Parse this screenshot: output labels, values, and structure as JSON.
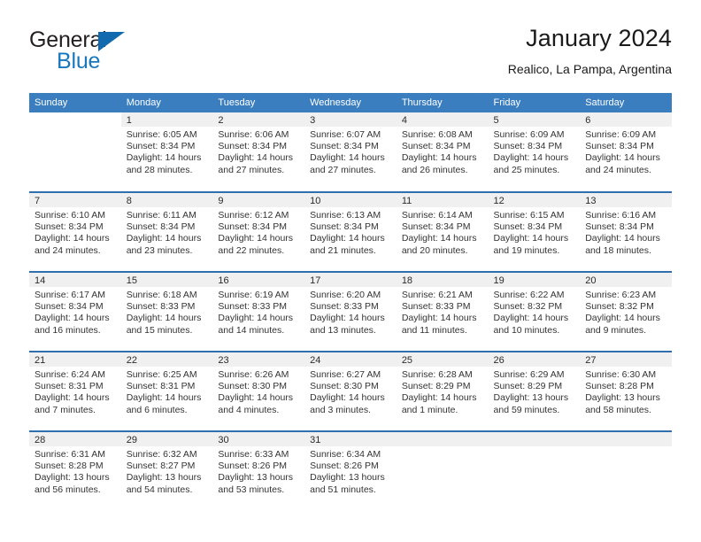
{
  "brand": {
    "name_top": "General",
    "name_bottom": "Blue",
    "triangle_icon": "triangle-icon"
  },
  "header": {
    "title": "January 2024",
    "subtitle": "Realico, La Pampa, Argentina"
  },
  "colors": {
    "header_blue": "#3a7ebf",
    "row_divider_blue": "#2f6fb0",
    "daynum_band": "#f0f0f0",
    "brand_blue": "#1878be",
    "brand_triangle": "#1169ae",
    "text": "#333333"
  },
  "weekday_headers": [
    "Sunday",
    "Monday",
    "Tuesday",
    "Wednesday",
    "Thursday",
    "Friday",
    "Saturday"
  ],
  "labels": {
    "sunrise_prefix": "Sunrise:",
    "sunset_prefix": "Sunset:",
    "daylight_prefix": "Daylight:"
  },
  "weeks": [
    {
      "days": [
        {
          "num": "",
          "empty": true,
          "band": false,
          "sunrise": "",
          "sunset": "",
          "daylight_a": "",
          "daylight_b": ""
        },
        {
          "num": "1",
          "sunrise": "Sunrise: 6:05 AM",
          "sunset": "Sunset: 8:34 PM",
          "daylight_a": "Daylight: 14 hours",
          "daylight_b": "and 28 minutes."
        },
        {
          "num": "2",
          "sunrise": "Sunrise: 6:06 AM",
          "sunset": "Sunset: 8:34 PM",
          "daylight_a": "Daylight: 14 hours",
          "daylight_b": "and 27 minutes."
        },
        {
          "num": "3",
          "sunrise": "Sunrise: 6:07 AM",
          "sunset": "Sunset: 8:34 PM",
          "daylight_a": "Daylight: 14 hours",
          "daylight_b": "and 27 minutes."
        },
        {
          "num": "4",
          "sunrise": "Sunrise: 6:08 AM",
          "sunset": "Sunset: 8:34 PM",
          "daylight_a": "Daylight: 14 hours",
          "daylight_b": "and 26 minutes."
        },
        {
          "num": "5",
          "sunrise": "Sunrise: 6:09 AM",
          "sunset": "Sunset: 8:34 PM",
          "daylight_a": "Daylight: 14 hours",
          "daylight_b": "and 25 minutes."
        },
        {
          "num": "6",
          "sunrise": "Sunrise: 6:09 AM",
          "sunset": "Sunset: 8:34 PM",
          "daylight_a": "Daylight: 14 hours",
          "daylight_b": "and 24 minutes."
        }
      ]
    },
    {
      "days": [
        {
          "num": "7",
          "sunrise": "Sunrise: 6:10 AM",
          "sunset": "Sunset: 8:34 PM",
          "daylight_a": "Daylight: 14 hours",
          "daylight_b": "and 24 minutes."
        },
        {
          "num": "8",
          "sunrise": "Sunrise: 6:11 AM",
          "sunset": "Sunset: 8:34 PM",
          "daylight_a": "Daylight: 14 hours",
          "daylight_b": "and 23 minutes."
        },
        {
          "num": "9",
          "sunrise": "Sunrise: 6:12 AM",
          "sunset": "Sunset: 8:34 PM",
          "daylight_a": "Daylight: 14 hours",
          "daylight_b": "and 22 minutes."
        },
        {
          "num": "10",
          "sunrise": "Sunrise: 6:13 AM",
          "sunset": "Sunset: 8:34 PM",
          "daylight_a": "Daylight: 14 hours",
          "daylight_b": "and 21 minutes."
        },
        {
          "num": "11",
          "sunrise": "Sunrise: 6:14 AM",
          "sunset": "Sunset: 8:34 PM",
          "daylight_a": "Daylight: 14 hours",
          "daylight_b": "and 20 minutes."
        },
        {
          "num": "12",
          "sunrise": "Sunrise: 6:15 AM",
          "sunset": "Sunset: 8:34 PM",
          "daylight_a": "Daylight: 14 hours",
          "daylight_b": "and 19 minutes."
        },
        {
          "num": "13",
          "sunrise": "Sunrise: 6:16 AM",
          "sunset": "Sunset: 8:34 PM",
          "daylight_a": "Daylight: 14 hours",
          "daylight_b": "and 18 minutes."
        }
      ]
    },
    {
      "days": [
        {
          "num": "14",
          "sunrise": "Sunrise: 6:17 AM",
          "sunset": "Sunset: 8:34 PM",
          "daylight_a": "Daylight: 14 hours",
          "daylight_b": "and 16 minutes."
        },
        {
          "num": "15",
          "sunrise": "Sunrise: 6:18 AM",
          "sunset": "Sunset: 8:33 PM",
          "daylight_a": "Daylight: 14 hours",
          "daylight_b": "and 15 minutes."
        },
        {
          "num": "16",
          "sunrise": "Sunrise: 6:19 AM",
          "sunset": "Sunset: 8:33 PM",
          "daylight_a": "Daylight: 14 hours",
          "daylight_b": "and 14 minutes."
        },
        {
          "num": "17",
          "sunrise": "Sunrise: 6:20 AM",
          "sunset": "Sunset: 8:33 PM",
          "daylight_a": "Daylight: 14 hours",
          "daylight_b": "and 13 minutes."
        },
        {
          "num": "18",
          "sunrise": "Sunrise: 6:21 AM",
          "sunset": "Sunset: 8:33 PM",
          "daylight_a": "Daylight: 14 hours",
          "daylight_b": "and 11 minutes."
        },
        {
          "num": "19",
          "sunrise": "Sunrise: 6:22 AM",
          "sunset": "Sunset: 8:32 PM",
          "daylight_a": "Daylight: 14 hours",
          "daylight_b": "and 10 minutes."
        },
        {
          "num": "20",
          "sunrise": "Sunrise: 6:23 AM",
          "sunset": "Sunset: 8:32 PM",
          "daylight_a": "Daylight: 14 hours",
          "daylight_b": "and 9 minutes."
        }
      ]
    },
    {
      "days": [
        {
          "num": "21",
          "sunrise": "Sunrise: 6:24 AM",
          "sunset": "Sunset: 8:31 PM",
          "daylight_a": "Daylight: 14 hours",
          "daylight_b": "and 7 minutes."
        },
        {
          "num": "22",
          "sunrise": "Sunrise: 6:25 AM",
          "sunset": "Sunset: 8:31 PM",
          "daylight_a": "Daylight: 14 hours",
          "daylight_b": "and 6 minutes."
        },
        {
          "num": "23",
          "sunrise": "Sunrise: 6:26 AM",
          "sunset": "Sunset: 8:30 PM",
          "daylight_a": "Daylight: 14 hours",
          "daylight_b": "and 4 minutes."
        },
        {
          "num": "24",
          "sunrise": "Sunrise: 6:27 AM",
          "sunset": "Sunset: 8:30 PM",
          "daylight_a": "Daylight: 14 hours",
          "daylight_b": "and 3 minutes."
        },
        {
          "num": "25",
          "sunrise": "Sunrise: 6:28 AM",
          "sunset": "Sunset: 8:29 PM",
          "daylight_a": "Daylight: 14 hours",
          "daylight_b": "and 1 minute."
        },
        {
          "num": "26",
          "sunrise": "Sunrise: 6:29 AM",
          "sunset": "Sunset: 8:29 PM",
          "daylight_a": "Daylight: 13 hours",
          "daylight_b": "and 59 minutes."
        },
        {
          "num": "27",
          "sunrise": "Sunrise: 6:30 AM",
          "sunset": "Sunset: 8:28 PM",
          "daylight_a": "Daylight: 13 hours",
          "daylight_b": "and 58 minutes."
        }
      ]
    },
    {
      "days": [
        {
          "num": "28",
          "sunrise": "Sunrise: 6:31 AM",
          "sunset": "Sunset: 8:28 PM",
          "daylight_a": "Daylight: 13 hours",
          "daylight_b": "and 56 minutes."
        },
        {
          "num": "29",
          "sunrise": "Sunrise: 6:32 AM",
          "sunset": "Sunset: 8:27 PM",
          "daylight_a": "Daylight: 13 hours",
          "daylight_b": "and 54 minutes."
        },
        {
          "num": "30",
          "sunrise": "Sunrise: 6:33 AM",
          "sunset": "Sunset: 8:26 PM",
          "daylight_a": "Daylight: 13 hours",
          "daylight_b": "and 53 minutes."
        },
        {
          "num": "31",
          "sunrise": "Sunrise: 6:34 AM",
          "sunset": "Sunset: 8:26 PM",
          "daylight_a": "Daylight: 13 hours",
          "daylight_b": "and 51 minutes."
        },
        {
          "num": "",
          "empty": true,
          "band": true,
          "sunrise": "",
          "sunset": "",
          "daylight_a": "",
          "daylight_b": ""
        },
        {
          "num": "",
          "empty": true,
          "band": true,
          "sunrise": "",
          "sunset": "",
          "daylight_a": "",
          "daylight_b": ""
        },
        {
          "num": "",
          "empty": true,
          "band": true,
          "sunrise": "",
          "sunset": "",
          "daylight_a": "",
          "daylight_b": ""
        }
      ]
    }
  ]
}
